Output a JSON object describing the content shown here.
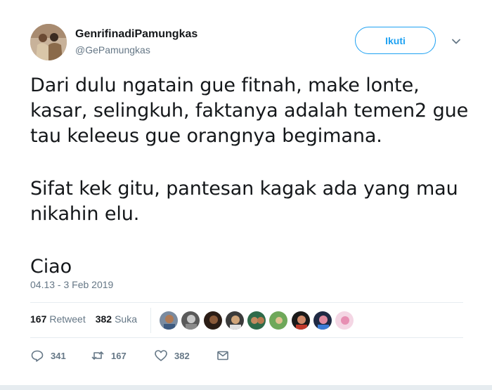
{
  "tweet": {
    "display_name": "GenrifinadiPamungkas",
    "handle": "@GePamungkas",
    "follow_label": "Ikuti",
    "text_lines": [
      "Dari dulu ngatain gue fitnah, make lonte,",
      "kasar, selingkuh, faktanya adalah temen2 gue",
      "tau keleeus gue orangnya begimana.",
      "Sifat kek gitu, pantesan kagak ada yang mau",
      "nikahin elu.",
      "Ciao"
    ],
    "timestamp": "04.13 - 3 Feb 2019",
    "retweet_count": "167",
    "retweet_label": "Retweet",
    "like_count": "382",
    "like_label": "Suka",
    "actions": {
      "reply_count": "341",
      "retweet_count": "167",
      "like_count": "382"
    }
  },
  "colors": {
    "accent": "#1da1f2",
    "muted": "#657786",
    "text": "#14171a",
    "divider": "#e6ecf0"
  },
  "icons": {
    "caret": "chevron-down-icon",
    "reply": "reply-icon",
    "retweet": "retweet-icon",
    "like": "heart-icon",
    "dm": "envelope-icon"
  }
}
